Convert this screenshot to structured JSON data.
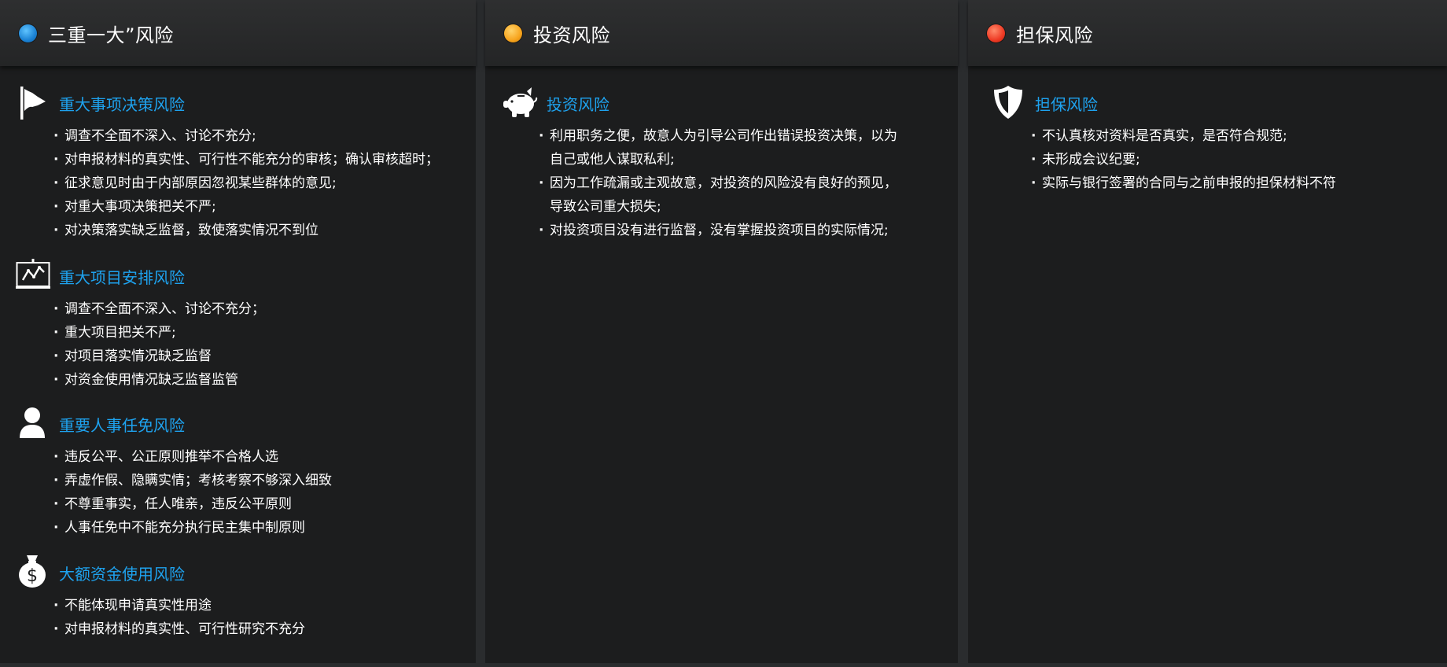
{
  "columns": [
    {
      "title": "三重一大”风险",
      "accent": "#1b82d4",
      "sections": [
        {
          "icon": "flag-icon",
          "title": "重大事项决策风险",
          "items": [
            "调查不全面不深入、讨论不充分;",
            "对申报材料的真实性、可行性不能充分的审核；确认审核超时；",
            "征求意见时由于内部原因忽视某些群体的意见;",
            "对重大事项决策把关不严;",
            "对决策落实缺乏监督，致使落实情况不到位"
          ]
        },
        {
          "icon": "presentation-chart-icon",
          "title": "重大项目安排风险",
          "items": [
            "调查不全面不深入、讨论不充分；",
            "重大项目把关不严;",
            "对项目落实情况缺乏监督",
            "对资金使用情况缺乏监督监管"
          ]
        },
        {
          "icon": "person-icon",
          "title": "重要人事任免风险",
          "items": [
            "违反公平、公正原则推举不合格人选",
            "弄虚作假、隐瞒实情；考核考察不够深入细致",
            "不尊重事实，任人唯亲，违反公平原则",
            "人事任免中不能充分执行民主集中制原则"
          ]
        },
        {
          "icon": "money-bag-icon",
          "title": "大额资金使用风险",
          "items": [
            "不能体现申请真实性用途",
            "对申报材料的真实性、可行性研究不充分"
          ]
        }
      ]
    },
    {
      "title": "投资风险",
      "accent": "#f7a41d",
      "sections": [
        {
          "icon": "piggy-bank-icon",
          "title": "投资风险",
          "items": [
            "利用职务之便，故意人为引导公司作出错误投资决策，以为",
            "自己或他人谋取私利;",
            "因为工作疏漏或主观故意，对投资的风险没有良好的预见，",
            "导致公司重大损失;",
            "对投资项目没有进行监督，没有掌握投资项目的实际情况;"
          ]
        }
      ]
    },
    {
      "title": "担保风险",
      "accent": "#ee3a24",
      "sections": [
        {
          "icon": "shield-icon",
          "title": "担保风险",
          "items": [
            "不认真核对资料是否真实，是否符合规范;",
            "未形成会议纪要;",
            "实际与银行签署的合同与之前申报的担保材料不符"
          ]
        }
      ]
    }
  ]
}
